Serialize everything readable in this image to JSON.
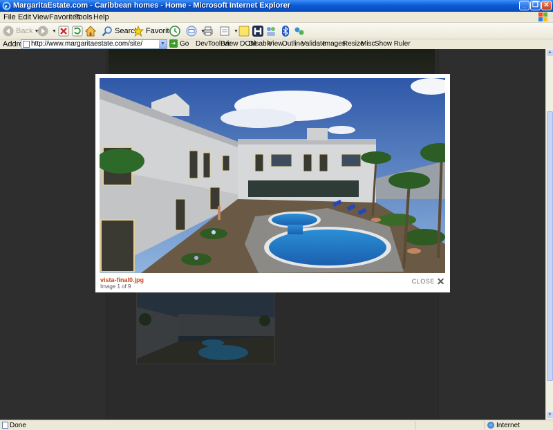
{
  "window": {
    "title": "MargaritaEstate.com - Caribbean homes - Home - Microsoft Internet Explorer",
    "controls": {
      "minimize": "_",
      "maximize": "❐",
      "close": "✕"
    }
  },
  "menu": [
    "File",
    "Edit",
    "View",
    "Favorites",
    "Tools",
    "Help"
  ],
  "toolbar": {
    "back": "Back",
    "search": "Search",
    "favorites": "Favorites"
  },
  "address": {
    "label": "Address",
    "url": "http://www.margaritaestate.com/site/",
    "go": "Go"
  },
  "devtools": [
    "DevToolBar",
    "View DOM",
    "Disable",
    "View",
    "Outline",
    "Validate",
    "Images",
    "Resize",
    "Misc",
    "Show Ruler"
  ],
  "lightbox": {
    "caption": "vista-final0.jpg",
    "counter": "Image 1 of 9",
    "close_label": "CLOSE"
  },
  "status": {
    "text": "Done",
    "zone": "Internet"
  },
  "colors": {
    "titlebar": "#0a5bd8",
    "caption": "#c24a1a",
    "overlay": "#2e2e2e"
  }
}
